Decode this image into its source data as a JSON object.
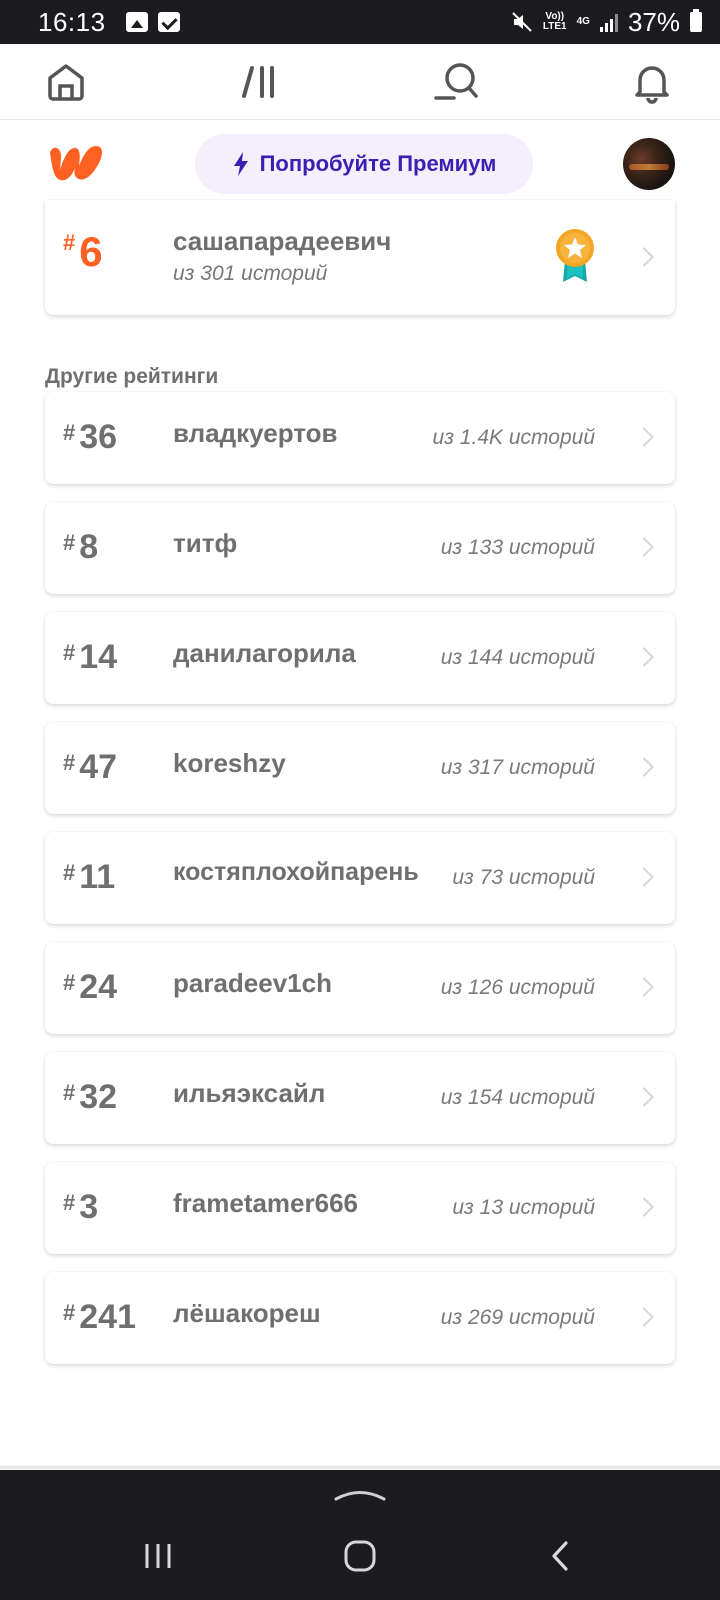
{
  "status_bar": {
    "time": "16:13",
    "network_top": "Vo))",
    "network_bottom": "LTE1",
    "network_type": "4G",
    "battery": "37%"
  },
  "top_nav": {
    "icons": [
      "home-icon",
      "library-icon",
      "search-icon",
      "bell-icon"
    ]
  },
  "header": {
    "premium_label": "Попробуйте Премиум",
    "brand_color": "#ff6122",
    "premium_color": "#3b1fb0"
  },
  "main_ranking": {
    "rank_prefix": "#",
    "rank": "6",
    "name": "сашапарадеевич",
    "subtitle": "из 301 историй"
  },
  "other_rankings": {
    "title": "Другие рейтинги",
    "items": [
      {
        "prefix": "#",
        "rank": "36",
        "name": "владкуертов",
        "count": "из 1.4K историй"
      },
      {
        "prefix": "#",
        "rank": "8",
        "name": "титф",
        "count": "из 133 историй"
      },
      {
        "prefix": "#",
        "rank": "14",
        "name": "данилагорила",
        "count": "из 144 историй"
      },
      {
        "prefix": "#",
        "rank": "47",
        "name": "koreshzy",
        "count": "из 317 историй"
      },
      {
        "prefix": "#",
        "rank": "11",
        "name": "костяплохойпарень",
        "count": "из 73 историй"
      },
      {
        "prefix": "#",
        "rank": "24",
        "name": "paradeev1ch",
        "count": "из 126 историй"
      },
      {
        "prefix": "#",
        "rank": "32",
        "name": "ильяэксайл",
        "count": "из 154 историй"
      },
      {
        "prefix": "#",
        "rank": "3",
        "name": "frametamer666",
        "count": "из 13 историй"
      },
      {
        "prefix": "#",
        "rank": "241",
        "name": "лёшакореш",
        "count": "из 269 историй"
      }
    ]
  }
}
